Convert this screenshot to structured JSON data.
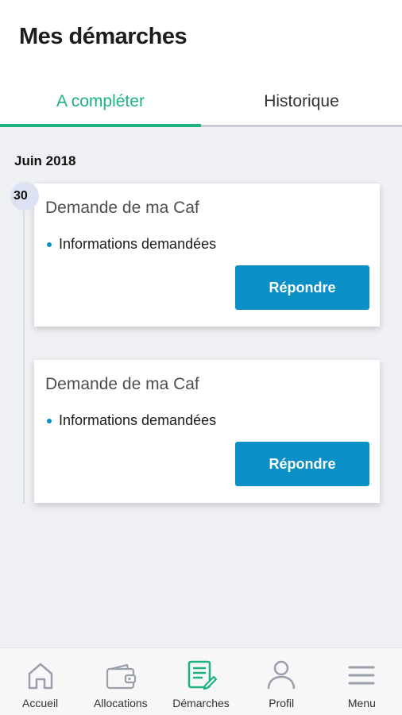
{
  "header": {
    "title": "Mes démarches"
  },
  "tabs": [
    {
      "label": "A compléter",
      "active": true
    },
    {
      "label": "Historique",
      "active": false
    }
  ],
  "timeline": {
    "month": "Juin 2018",
    "day": "30"
  },
  "cards": [
    {
      "title": "Demande de ma Caf",
      "item": "Informations demandées",
      "button": "Répondre"
    },
    {
      "title": "Demande de ma Caf",
      "item": "Informations demandées",
      "button": "Répondre"
    }
  ],
  "bottom_nav": {
    "items": [
      {
        "label": "Accueil",
        "icon": "home-icon"
      },
      {
        "label": "Allocations",
        "icon": "wallet-icon"
      },
      {
        "label": "Démarches",
        "icon": "document-edit-icon",
        "active": true
      },
      {
        "label": "Profil",
        "icon": "user-icon"
      },
      {
        "label": "Menu",
        "icon": "menu-icon"
      }
    ]
  },
  "colors": {
    "accent_green": "#1db37c",
    "button_blue": "#0a8fc7",
    "background": "#eef0f3"
  }
}
